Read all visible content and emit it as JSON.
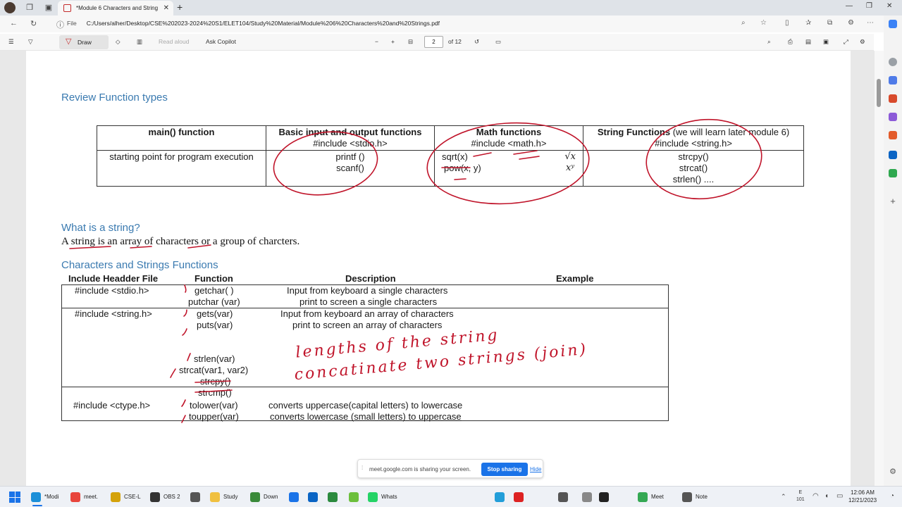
{
  "browser": {
    "tab_title": "*Module 6 Characters and String",
    "address_label": "File",
    "url": "C:/Users/alher/Desktop/CSE%202023-2024%20S1/ELET104/Study%20Material/Module%206%20Characters%20and%20Strings.pdf"
  },
  "pdf_toolbar": {
    "draw_label": "Draw",
    "read_aloud_label": "Read aloud",
    "copilot_label": "Ask Copilot",
    "current_page": "2",
    "page_total": "of 12"
  },
  "document": {
    "section1_title": "Review Function types",
    "table1": {
      "headers": [
        {
          "title": "main() function",
          "sub": ""
        },
        {
          "title": "Basic input and output functions",
          "sub": "#include <stdio.h>"
        },
        {
          "title": "Math functions",
          "sub": "#include <math.h>"
        },
        {
          "title": "String Functions",
          "title_extra": " (we will learn later module 6)",
          "sub": "#include <string.h>"
        }
      ],
      "main_desc": "starting point for program execution",
      "io_funcs": [
        "printf ()",
        "scanf()"
      ],
      "math_funcs": [
        "sqrt(x)",
        "pow(x, y)"
      ],
      "math_symbols": [
        "√x",
        "xʸ"
      ],
      "string_funcs": [
        "strcpy()",
        "strcat()",
        "strlen()    ...."
      ]
    },
    "section2_title": "What is a string?",
    "string_definition": "A string is an array of characters or a group of charcters.",
    "section3_title": "Characters and Strings Functions",
    "table2": {
      "headers": [
        "Include Headder File",
        "Function",
        "Description",
        "Example"
      ],
      "groups": [
        {
          "header_file": "#include  <stdio.h>",
          "rows": [
            {
              "function": "getchar( )",
              "description": "Input from keyboard a single characters"
            },
            {
              "function": "putchar (var)",
              "description": "print to screen a single characters"
            }
          ]
        },
        {
          "header_file": "#include <string.h>",
          "rows": [
            {
              "function": "gets(var)",
              "description": "Input from keyboard an array of characters"
            },
            {
              "function": "puts(var)",
              "description": "print to screen an array of characters"
            },
            {
              "function": "",
              "description": ""
            },
            {
              "function": "strlen(var)",
              "description": ""
            },
            {
              "function": "strcat(var1, var2)",
              "description": ""
            },
            {
              "function": "strcpy()",
              "description": ""
            },
            {
              "function": "strcmp()",
              "description": ""
            }
          ]
        },
        {
          "header_file": "#include  <ctype.h>",
          "rows": [
            {
              "function": "tolower(var)",
              "description": "converts uppercase(capital letters) to lowercase"
            },
            {
              "function": "toupper(var)",
              "description": "converts lowercase (small letters) to uppercase"
            }
          ]
        }
      ]
    },
    "handwriting": [
      "lengths of the string",
      "concatinate two strings (join)"
    ]
  },
  "share_banner": {
    "message": "meet.google.com is sharing your screen.",
    "stop_label": "Stop sharing",
    "hide_label": "Hide"
  },
  "taskbar": {
    "items": [
      {
        "label": "*Modi",
        "color": "#1b8fd8"
      },
      {
        "label": "meet.",
        "color": "#e8453c"
      },
      {
        "label": "CSE-L",
        "color": "#d4a20a"
      },
      {
        "label": "OBS 2",
        "color": "#333333"
      },
      {
        "label": "",
        "color": "#555555"
      },
      {
        "label": "Study",
        "color": "#f0c040"
      },
      {
        "label": "Down",
        "color": "#3a8a3a"
      },
      {
        "label": "",
        "color": "#1a73e8"
      },
      {
        "label": "",
        "color": "#0a64c4"
      },
      {
        "label": "",
        "color": "#2b8a3e"
      },
      {
        "label": "",
        "color": "#6cbf3c"
      },
      {
        "label": "Whats",
        "color": "#25d366"
      },
      {
        "label": "",
        "color": "#229ed9"
      },
      {
        "label": "",
        "color": "#d22"
      },
      {
        "label": "",
        "color": "#555"
      },
      {
        "label": "",
        "color": "#888"
      },
      {
        "label": "",
        "color": "#222"
      },
      {
        "label": "Meet",
        "color": "#34a853"
      },
      {
        "label": "Note",
        "color": "#555"
      }
    ],
    "lang": "E\n101",
    "time": "12:06 AM",
    "date": "12/21/2023"
  }
}
